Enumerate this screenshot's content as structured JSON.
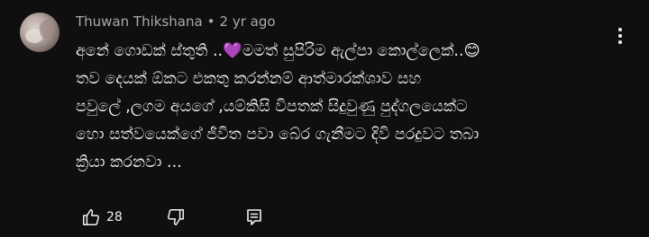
{
  "comment": {
    "author": "Thuwan Thikshana",
    "separator": "•",
    "time": "2 yr ago",
    "text_lines": [
      "අනේ ගොඩක් ස්තුති ..💜මමත් සුපිරිම ඇල්පා කොල්ලෙක්..😊",
      "තව දෙයක් ඕකට එකතු කරන්නම් ආත්මාරක්ශාව සහ",
      "පවුලේ ,ලගම අයගේ ,යම්කිසි විපතක් සිදුවුණු පුද්ගලයෙක්ට",
      "හො සත්වයෙක්ගේ ජීවිත පවා බේර ගැනීමට දිවි පරදුවට තබා",
      "ක්‍රියා කරනවා ..."
    ],
    "like_count": "28"
  },
  "icons": {
    "avatar": "user-avatar",
    "menu": "more-vert-icon",
    "like": "thumb-up-icon",
    "dislike": "thumb-down-icon",
    "reply": "reply-comment-icon"
  },
  "colors": {
    "background": "#0f0f0f",
    "text": "#f1f1f1",
    "meta": "#aaaaaa"
  }
}
